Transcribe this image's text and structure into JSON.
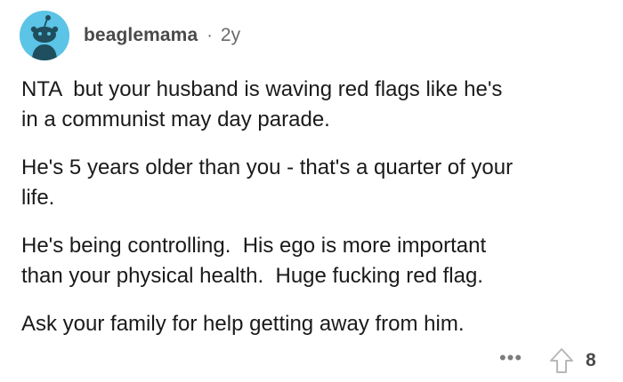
{
  "comment": {
    "author": "beaglemama",
    "separator": "·",
    "age": "2y",
    "paragraphs": [
      "NTA  but your husband is waving red flags like he's\nin a communist may day parade.",
      "He's 5 years older than you - that's a quarter of your\nlife.",
      "He's being controlling.  His ego is more important\nthan your physical health.  Huge fucking red flag.",
      "Ask your family for help getting away from him."
    ],
    "more_label": "•••",
    "score": "8",
    "icons": {
      "avatar": "snoo-avatar-icon",
      "upvote": "upvote-arrow-icon"
    }
  },
  "colors": {
    "avatar_bg": "#5cc4e6",
    "text": "#1a1a1b",
    "meta": "#6a6a6b"
  }
}
